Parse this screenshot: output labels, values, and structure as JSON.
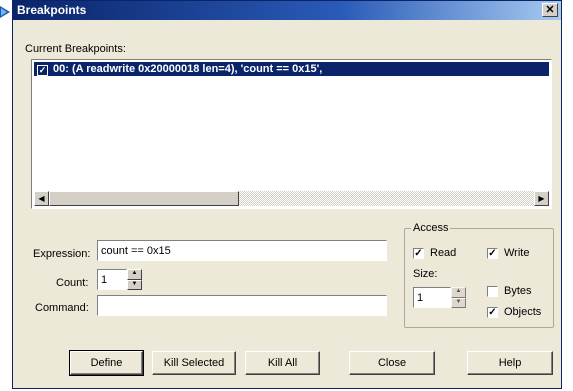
{
  "window": {
    "title": "Breakpoints",
    "close_glyph": "✕"
  },
  "current_label": "Current Breakpoints:",
  "breakpoints": [
    {
      "checked": true,
      "text": "00: (A readwrite 0x20000018 len=4),  'count == 0x15',"
    }
  ],
  "scrollbar": {
    "left_arrow": "◀",
    "right_arrow": "▶"
  },
  "fields": {
    "expression": {
      "label": "Expression:",
      "value": "count == 0x15"
    },
    "count": {
      "label": "Count:",
      "value": "1"
    },
    "command": {
      "label": "Command:",
      "value": ""
    }
  },
  "access": {
    "title": "Access",
    "read": {
      "label": "Read",
      "checked": true
    },
    "write": {
      "label": "Write",
      "checked": true
    },
    "size_label": "Size:",
    "size_value": "1",
    "bytes": {
      "label": "Bytes",
      "checked": false
    },
    "objects": {
      "label": "Objects",
      "checked": true
    }
  },
  "buttons": {
    "define": "Define",
    "kill_selected": "Kill Selected",
    "kill_all": "Kill All",
    "close": "Close",
    "help": "Help"
  },
  "icons": {
    "spin_up": "▲",
    "spin_down": "▼",
    "check": "✓"
  }
}
